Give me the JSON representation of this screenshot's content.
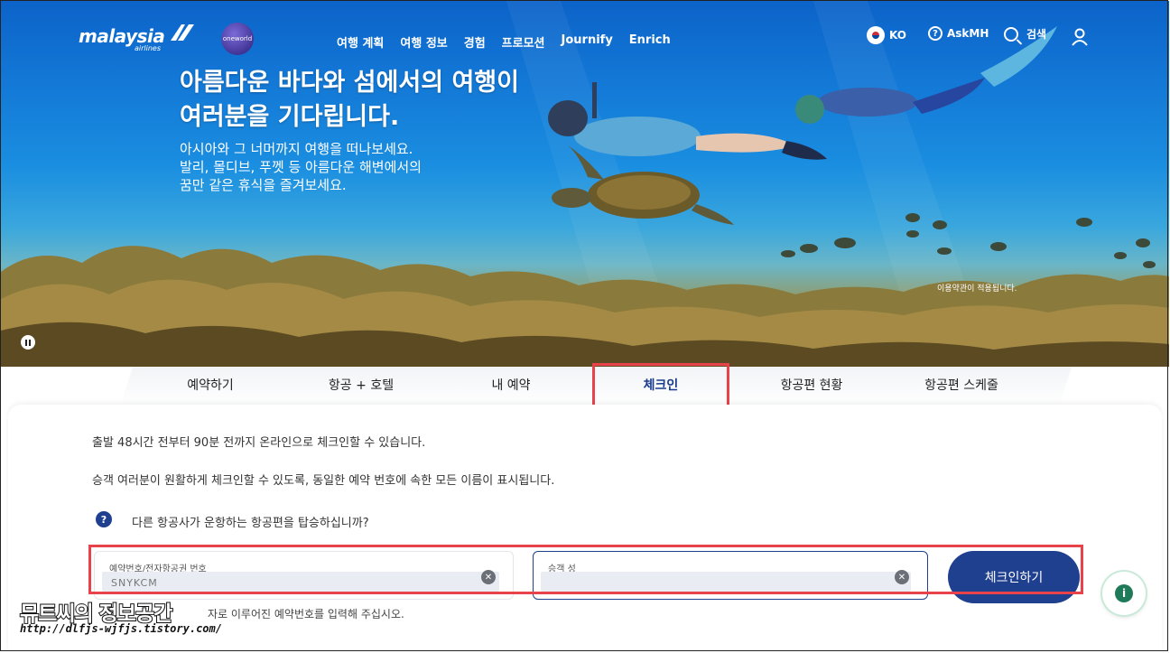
{
  "nav": {
    "logo_text": "malaysia",
    "logo_sub": "airlines",
    "oneworld": "oneworld",
    "menu": [
      "여행 계획",
      "여행 정보",
      "경험",
      "프로모션",
      "Journify",
      "Enrich"
    ],
    "lang": "KO",
    "askmh": "AskMH",
    "search": "검색"
  },
  "hero": {
    "headline_1": "아름다운 바다와 섬에서의 여행이",
    "headline_2": "여러분을 기다립니다.",
    "sub_1": "아시아와 그 너머까지 여행을 떠나보세요.",
    "sub_2": "발리, 몰디브, 푸껫 등 아름다운 해변에서의",
    "sub_3": "꿈만 같은 휴식을 즐겨보세요.",
    "terms": "이용약관이 적용됩니다."
  },
  "tabs": [
    "예약하기",
    "항공 + 호텔",
    "내 예약",
    "체크인",
    "항공편 현황",
    "항공편 스케줄"
  ],
  "active_tab": "체크인",
  "checkin": {
    "info_1": "출발 48시간 전부터 90분 전까지 온라인으로 체크인할 수 있습니다.",
    "info_2": "승객 여러분이 원활하게 체크인할 수 있도록, 동일한 예약 번호에 속한 모든 이름이 표시됩니다.",
    "other_airline_q": "다른 항공사가 운항하는 항공편을 탑승하십니까?",
    "booking_label": "예약번호/전자항공권 번호",
    "booking_value": "SNYKCM",
    "lastname_label": "승객 성",
    "submit": "체크인하기",
    "hint": "자로 이루어진 예약번호를 입력해 주십시오."
  },
  "watermark": {
    "title": "뮤트씨의 정보공간",
    "url": "http://dlfjs-wjfjs.tistory.com/"
  },
  "colors": {
    "brand": "#1f3f8f",
    "highlight": "#e8434a"
  }
}
